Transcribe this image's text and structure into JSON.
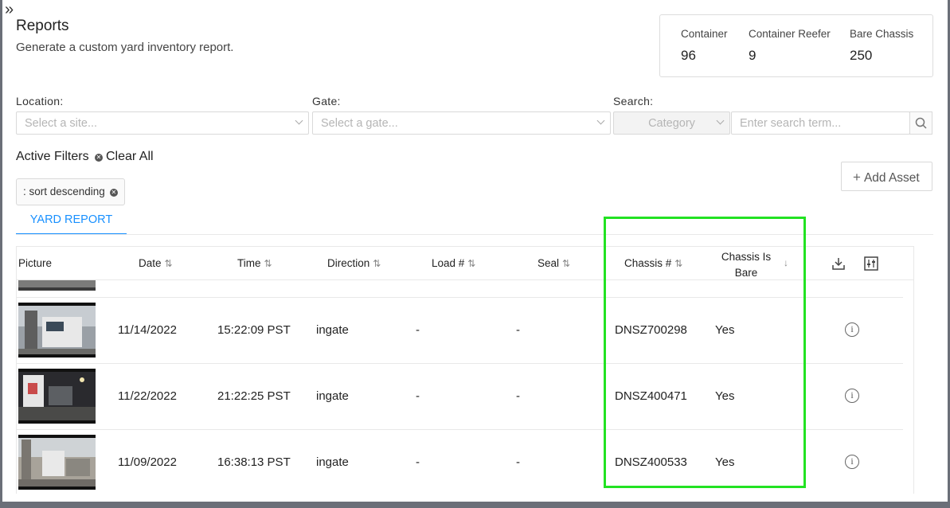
{
  "header": {
    "expand_icon": "chevrons-right-icon",
    "title": "Reports",
    "subtitle": "Generate a custom yard inventory report."
  },
  "stats": [
    {
      "label": "Container",
      "value": "96"
    },
    {
      "label": "Container Reefer",
      "value": "9"
    },
    {
      "label": "Bare Chassis",
      "value": "250"
    }
  ],
  "filters": {
    "location_label": "Location:",
    "location_placeholder": "Select a site...",
    "gate_label": "Gate:",
    "gate_placeholder": "Select a gate...",
    "search_label": "Search:",
    "category_placeholder": "Category",
    "search_placeholder": "Enter search term..."
  },
  "active_filters": {
    "title": "Active Filters",
    "clear_all": "Clear All",
    "chips": [
      ": sort descending"
    ]
  },
  "add_asset_label": "Add Asset",
  "tabs": [
    {
      "label": "YARD REPORT",
      "active": true
    }
  ],
  "table": {
    "columns": {
      "picture": "Picture",
      "date": "Date",
      "time": "Time",
      "direction": "Direction",
      "load": "Load #",
      "seal": "Seal",
      "chassis": "Chassis #",
      "chassis_bare": "Chassis Is Bare"
    },
    "rows": [
      {
        "date": "11/14/2022",
        "time": "15:22:09 PST",
        "direction": "ingate",
        "load": "-",
        "seal": "-",
        "chassis": "DNSZ700298",
        "bare": "Yes"
      },
      {
        "date": "11/22/2022",
        "time": "21:22:25 PST",
        "direction": "ingate",
        "load": "-",
        "seal": "-",
        "chassis": "DNSZ400471",
        "bare": "Yes"
      },
      {
        "date": "11/09/2022",
        "time": "16:38:13 PST",
        "direction": "ingate",
        "load": "-",
        "seal": "-",
        "chassis": "DNSZ400533",
        "bare": "Yes"
      }
    ]
  },
  "colors": {
    "accent": "#1890ff",
    "highlight": "#22e222"
  }
}
